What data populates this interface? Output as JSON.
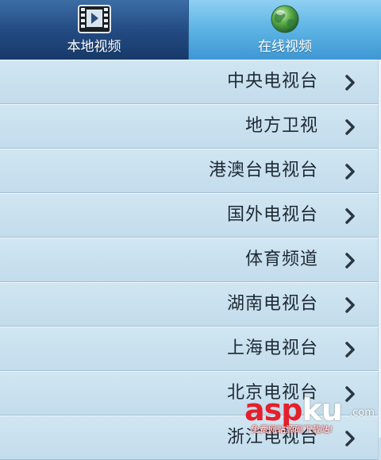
{
  "tabs": [
    {
      "label": "本地视频",
      "icon": "film-icon",
      "selected": true
    },
    {
      "label": "在线视频",
      "icon": "globe-icon",
      "selected": false
    }
  ],
  "channels": [
    {
      "label": "中央电视台"
    },
    {
      "label": "地方卫视"
    },
    {
      "label": "港澳台电视台"
    },
    {
      "label": "国外电视台"
    },
    {
      "label": "体育频道"
    },
    {
      "label": "湖南电视台"
    },
    {
      "label": "上海电视台"
    },
    {
      "label": "北京电视台"
    },
    {
      "label": "浙江电视台"
    }
  ],
  "watermark": {
    "brand_red": "asp",
    "brand_white": "ku",
    "domain": ".com",
    "tagline": "免费网站源码下载站!"
  },
  "colors": {
    "local_tab": "#234c83",
    "online_tab": "#5db4e4",
    "row_bg": "#c8e0ee",
    "text": "#1e2a33",
    "chevron": "#2b3740"
  }
}
